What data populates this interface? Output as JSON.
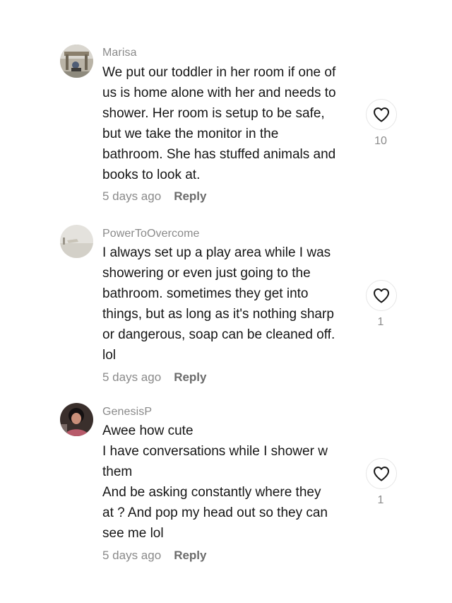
{
  "comments": [
    {
      "username": "Marisa",
      "lines": [
        "We put our toddler in her room if one of",
        "us is home alone with her and needs to",
        "shower. Her room is setup to be safe,",
        "but we take the monitor in the",
        "bathroom. She has stuffed animals and",
        "books to look at."
      ],
      "time": "5 days ago",
      "reply_label": "Reply",
      "likes": "10",
      "avatar_icon": "photo-avatar-outdoor"
    },
    {
      "username": "PowerToOvercome",
      "lines": [
        "I always set up a play area while I was",
        "showering or even just going to the",
        "bathroom. sometimes they get into",
        "things, but as long as it's nothing sharp",
        "or dangerous, soap can be cleaned off.",
        "lol"
      ],
      "time": "5 days ago",
      "reply_label": "Reply",
      "likes": "1",
      "avatar_icon": "photo-avatar-light"
    },
    {
      "username": "GenesisP",
      "lines": [
        "Awee how cute",
        "I have conversations while I shower w",
        "them",
        "And be asking constantly where they",
        "at ? And pop my head out so they can",
        "see me lol"
      ],
      "time": "5 days ago",
      "reply_label": "Reply",
      "likes": "1",
      "avatar_icon": "photo-avatar-person"
    }
  ],
  "colors": {
    "text": "#161616",
    "muted": "#8a8a8a",
    "reply": "#6b6b6b",
    "border": "#e6e6e6"
  },
  "icons": {
    "like": "heart-outline-icon"
  }
}
